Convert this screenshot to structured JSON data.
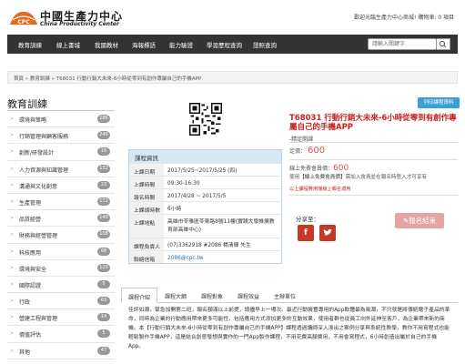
{
  "header": {
    "logo_cn": "中國生產力中心",
    "logo_en": "China Productivity Center",
    "logo_mark": "CPC",
    "welcome": "歡迎光臨生產力中心商城! 購物車: 0 項目"
  },
  "nav": {
    "items": [
      "教育訓練",
      "線上書城",
      "我國教材",
      "海報標語",
      "能力驗證",
      "學習歷程查詢",
      "證照查詢"
    ],
    "search_placeholder": "請輸入關鍵字"
  },
  "breadcrumb": "首頁 » 教育訓練 » T68031 行動行銷大未來-6小時從零到有創作專屬自己的手機APP",
  "sidebar": {
    "title": "教育訓練",
    "items": [
      {
        "label": "環境與策略",
        "count": "186"
      },
      {
        "label": "行銷管理與顧客服務",
        "count": "246"
      },
      {
        "label": "創新/研發設計",
        "count": "16"
      },
      {
        "label": "人力資源與知識管理",
        "count": "132"
      },
      {
        "label": "溝通與文化創意",
        "count": "23"
      },
      {
        "label": "生產管理",
        "count": "172"
      },
      {
        "label": "品質經營",
        "count": "140"
      },
      {
        "label": "財務與經營管理",
        "count": "108"
      },
      {
        "label": "科技應用",
        "count": "68"
      },
      {
        "label": "環境與安全",
        "count": "120"
      },
      {
        "label": "國際認證",
        "count": "5"
      },
      {
        "label": "行政",
        "count": "63"
      },
      {
        "label": "營建工程與管理",
        "count": "14"
      },
      {
        "label": "價值評估",
        "count": "5"
      },
      {
        "label": "其他",
        "count": "47"
      }
    ]
  },
  "info": {
    "head": "課程資訊",
    "rows": [
      {
        "k": "上課日期",
        "v": "2017/5/25~2017/5/25 (四)"
      },
      {
        "k": "上課時間",
        "v": "09:30-16:30"
      },
      {
        "k": "報名時間",
        "v": "2017/4/28 ~ 2017/5/5"
      },
      {
        "k": "上課總時數",
        "v": "6小時"
      },
      {
        "k": "上課地點",
        "v": "高雄市苓雅區苓東路8號11樓(實踐大學推廣教育部高雄中心)"
      },
      {
        "k": "課程負責人",
        "v": "(07)3362918 #2086 楊清輝 先生"
      },
      {
        "k": "聯絡信箱",
        "v": "2086@cpc.tw"
      }
    ]
  },
  "course": {
    "print_button": "列印課程資料",
    "title": "T68031 行動行銷大未來-6小時從零到有創作專屬自己的手機APP",
    "subtitle": "-精定開課",
    "price_label": "定價：",
    "price": "600",
    "member_label": "線上免費會員價：",
    "member_price": "600",
    "use_text_pre": "使用",
    "use_text_em": "【線上免費會員價】",
    "use_text_post": "需加入會員並在報名時登入才可享有",
    "red_note": "以上課程費用僅線上報名適用",
    "share_label": "分享至：",
    "end_button": "報名結束"
  },
  "tabs": {
    "items": [
      "課程介紹",
      "課程大綱",
      "課程對象",
      "課程效益",
      "主辦單位"
    ],
    "active": 0,
    "body": "佳評如潮，緊急加開第二班，報名額滿以上前提，請儘早上一場次。最近行動裝置專用的App軟體最為風潮，不只就是將傳統電子產品的革命，同時為企業的行動應用帶來更多可能性，包括應用方式添加更多的互動效果，使用者群也從員工向外延伸至客戶，為企業帶來新的商機。本【行動行銷大未來-6小時從零到有創作專屬自己的手機APP】課程透過講師深入淺出之案例分享與系統性教學，教你不用寫程式也能輕鬆製作手機APP，這是結合創意發想與實作的一門App製作課程，不用花費高額費用，不用會寫程式，6小時創造出屬於自己的手機App。"
  },
  "colors": {
    "nav_bg": "#333333",
    "accent_red": "#c7211f",
    "price_red": "#e05050",
    "info_head": "#d7e8f5",
    "print_btn": "#3aa0d8",
    "end_btn": "#e4a5a5"
  }
}
